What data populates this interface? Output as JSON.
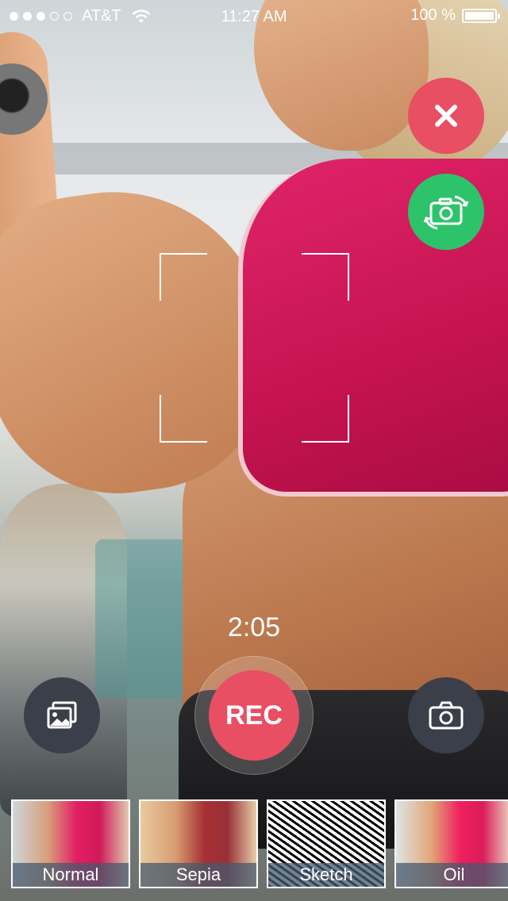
{
  "status_bar": {
    "carrier": "AT&T",
    "time": "11:27 AM",
    "battery": "100 %",
    "signal_dots_filled": 3,
    "signal_dots_total": 5
  },
  "buttons": {
    "close_icon": "close-icon",
    "switch_camera_icon": "switch-camera-icon",
    "gallery_icon": "gallery-icon",
    "camera_icon": "camera-icon",
    "rec_label": "REC"
  },
  "timer": "2:05",
  "filters": [
    {
      "label": "Normal"
    },
    {
      "label": "Sepia"
    },
    {
      "label": "Sketch"
    },
    {
      "label": "Oil"
    }
  ],
  "colors": {
    "close": "#e84f63",
    "switch": "#2dc36a",
    "rec": "#e84f63",
    "dark_button": "#3a3f49"
  }
}
